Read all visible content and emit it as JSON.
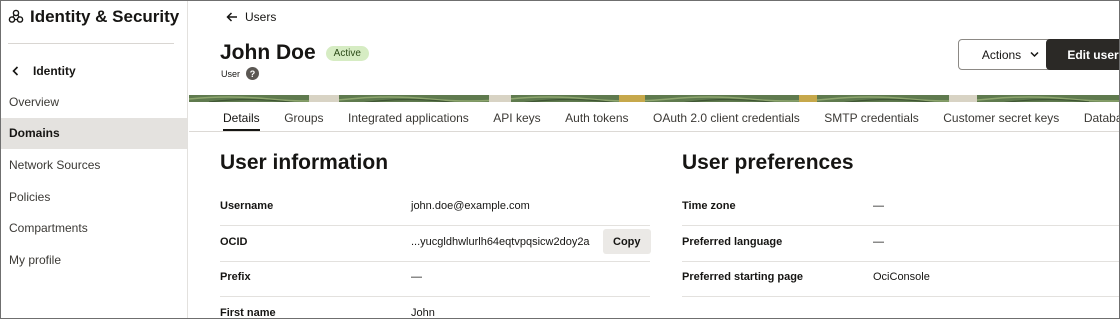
{
  "sidebar": {
    "title": "Identity & Security",
    "back_label": "Identity",
    "items": [
      {
        "label": "Overview",
        "active": false
      },
      {
        "label": "Domains",
        "active": true
      },
      {
        "label": "Network Sources",
        "active": false
      },
      {
        "label": "Policies",
        "active": false
      },
      {
        "label": "Compartments",
        "active": false
      },
      {
        "label": "My profile",
        "active": false
      }
    ]
  },
  "header": {
    "breadcrumb": "Users",
    "title": "John Doe",
    "status": "Active",
    "subtitle": "User",
    "help_icon": "?",
    "actions_label": "Actions",
    "edit_label": "Edit user"
  },
  "tabs": [
    {
      "label": "Details",
      "active": true
    },
    {
      "label": "Groups",
      "active": false
    },
    {
      "label": "Integrated applications",
      "active": false
    },
    {
      "label": "API keys",
      "active": false
    },
    {
      "label": "Auth tokens",
      "active": false
    },
    {
      "label": "OAuth 2.0 client credentials",
      "active": false
    },
    {
      "label": "SMTP credentials",
      "active": false
    },
    {
      "label": "Customer secret keys",
      "active": false
    },
    {
      "label": "Database passwords",
      "active": false
    }
  ],
  "user_info": {
    "title": "User information",
    "copy_label": "Copy",
    "rows": [
      {
        "label": "Username",
        "value": "john.doe@example.com"
      },
      {
        "label": "OCID",
        "value": "...yucgldhwlurlh64eqtvpqsicw2doy2a"
      },
      {
        "label": "Prefix",
        "value": "—"
      },
      {
        "label": "First name",
        "value": "John"
      }
    ]
  },
  "user_prefs": {
    "title": "User preferences",
    "rows": [
      {
        "label": "Time zone",
        "value": "—"
      },
      {
        "label": "Preferred language",
        "value": "—"
      },
      {
        "label": "Preferred starting page",
        "value": "OciConsole"
      }
    ]
  },
  "colors": {
    "primary_button": "#2b2926",
    "active_nav": "#e4e2df",
    "status_badge_bg": "#d6ecc3",
    "banner_green": "#5f7a4e"
  },
  "icons": {
    "brand": "identity-security-icon",
    "back": "chevron-left-icon",
    "breadcrumb": "arrow-left-icon",
    "actions": "chevron-down-icon",
    "help": "help-icon"
  }
}
